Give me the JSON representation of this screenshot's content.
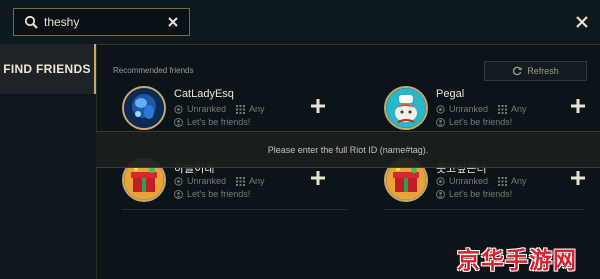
{
  "search": {
    "value": "theshy"
  },
  "sidebar": {
    "find_friends_label": "FIND FRIENDS"
  },
  "recommended": {
    "header": "Recommended friends",
    "refresh_label": "Refresh",
    "friends": [
      {
        "name": "CatLadyEsq",
        "rank": "Unranked",
        "queue": "Any",
        "message": "Let's be friends!",
        "avatar": "blue-champion-avatar"
      },
      {
        "name": "Pegal",
        "rank": "Unranked",
        "queue": "Any",
        "message": "Let's be friends!",
        "avatar": "poro-chef-avatar"
      },
      {
        "name": "하늘이래",
        "rank": "Unranked",
        "queue": "Any",
        "message": "Let's be friends!",
        "avatar": "gift-box-avatar"
      },
      {
        "name": "못고싶은너",
        "rank": "Unranked",
        "queue": "Any",
        "message": "Let's be friends!",
        "avatar": "gift-box-avatar"
      }
    ]
  },
  "notice": {
    "text": "Please enter the full Riot ID (name#tag)."
  },
  "watermark": {
    "text": "京华手游网"
  },
  "colors": {
    "gold": "#c8aa6e",
    "background": "#0b1419",
    "text": "#c8c3b4",
    "watermark_red": "#d9232e"
  }
}
